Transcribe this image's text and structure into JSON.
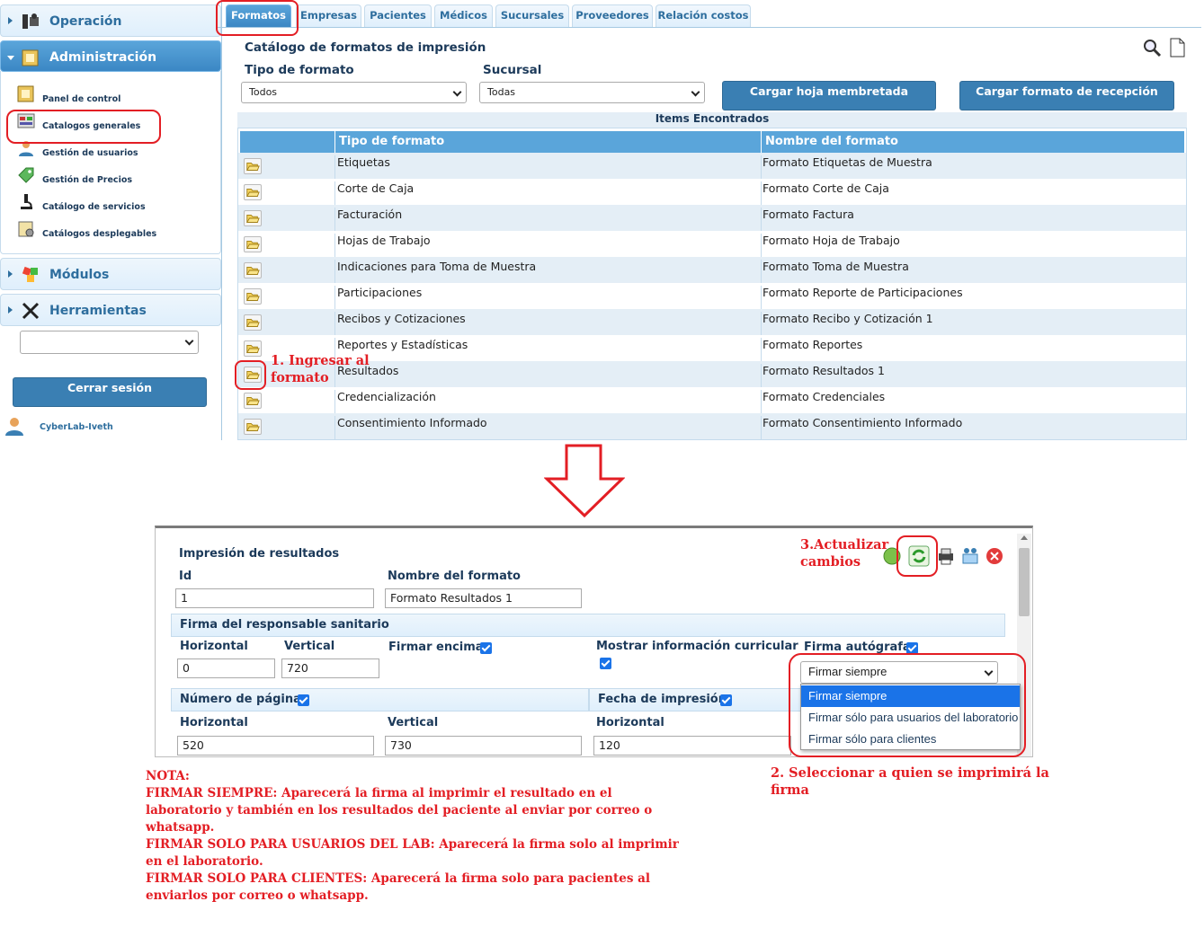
{
  "sidebar": {
    "sections": [
      "Operación",
      "Administración",
      "Módulos",
      "Herramientas"
    ],
    "admin_items": [
      "Panel de control",
      "Catalogos generales",
      "Gestión de usuarios",
      "Gestión de Precios",
      "Catálogo de servicios",
      "Catálogos desplegables"
    ],
    "logout_label": "Cerrar sesión",
    "user_name": "CyberLab-Iveth"
  },
  "tabs": [
    "Formatos",
    "Empresas",
    "Pacientes",
    "Médicos",
    "Sucursales",
    "Proveedores",
    "Relación costos"
  ],
  "catalog": {
    "title": "Catálogo de formatos de impresión",
    "tipo_label": "Tipo de formato",
    "tipo_value": "Todos",
    "sucursal_label": "Sucursal",
    "sucursal_value": "Todas",
    "btn_membretada": "Cargar hoja membretada",
    "btn_recepcion": "Cargar formato de recepción",
    "items_found": "Items Encontrados",
    "col_tipo": "Tipo de formato",
    "col_nombre": "Nombre del formato",
    "rows": [
      {
        "tipo": "Etiquetas",
        "nombre": "Formato Etiquetas de Muestra"
      },
      {
        "tipo": "Corte de Caja",
        "nombre": "Formato Corte de Caja"
      },
      {
        "tipo": "Facturación",
        "nombre": "Formato Factura"
      },
      {
        "tipo": "Hojas de Trabajo",
        "nombre": "Formato Hoja de Trabajo"
      },
      {
        "tipo": "Indicaciones para Toma de Muestra",
        "nombre": "Formato Toma de Muestra"
      },
      {
        "tipo": "Participaciones",
        "nombre": "Formato Reporte de Participaciones"
      },
      {
        "tipo": "Recibos y Cotizaciones",
        "nombre": "Formato Recibo y Cotización 1"
      },
      {
        "tipo": "Reportes y Estadísticas",
        "nombre": "Formato Reportes"
      },
      {
        "tipo": "Resultados",
        "nombre": "Formato Resultados 1"
      },
      {
        "tipo": "Credencialización",
        "nombre": "Formato Credenciales"
      },
      {
        "tipo": "Consentimiento Informado",
        "nombre": "Formato Consentimiento Informado"
      }
    ]
  },
  "annotations": {
    "step1": "1. Ingresar al formato",
    "step2": "2. Seleccionar a quien se imprimirá la firma",
    "step3": "3.Actualizar cambios"
  },
  "form": {
    "title": "Impresión de resultados",
    "id_label": "Id",
    "id_value": "1",
    "nombre_label": "Nombre del formato",
    "nombre_value": "Formato Resultados 1",
    "firma_section": "Firma del responsable sanitario",
    "horizontal_label": "Horizontal",
    "vertical_label": "Vertical",
    "firma_h": "0",
    "firma_v": "720",
    "firmar_encima": "Firmar encima",
    "mostrar_info": "Mostrar información curricular",
    "firma_autografa": "Firma autógrafa",
    "firma_select_value": "Firmar siempre",
    "firma_options": [
      "Firmar siempre",
      "Firmar sólo para usuarios del laboratorio",
      "Firmar sólo para clientes"
    ],
    "numero_pagina": "Número de página",
    "fecha_impresion": "Fecha de impresión",
    "np_h": "520",
    "np_v": "730",
    "fi_h": "120"
  },
  "note": {
    "heading": "NOTA:",
    "lines": [
      "FIRMAR SIEMPRE: Aparecerá la firma al imprimir el resultado en el laboratorio y también en los resultados del paciente al enviar por correo o whatsapp.",
      "FIRMAR SOLO PARA USUARIOS DEL LAB: Aparecerá la firma solo al imprimir en el laboratorio.",
      "FIRMAR SOLO PARA CLIENTES: Aparecerá la firma solo para pacientes al enviarlos por correo o whatsapp."
    ]
  },
  "colors": {
    "accent": "#3b87c4",
    "header_blue": "#5aa5da",
    "annotation_red": "#e31e24",
    "selected_option": "#1a73e8"
  }
}
